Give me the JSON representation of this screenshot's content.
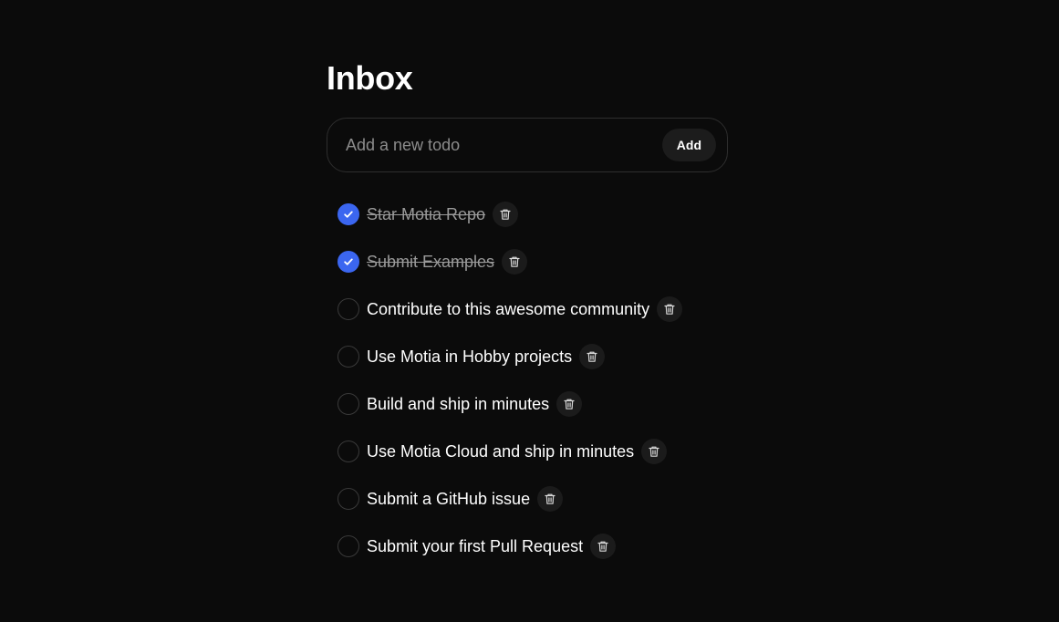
{
  "page": {
    "title": "Inbox"
  },
  "add_form": {
    "placeholder": "Add a new todo",
    "value": "",
    "button_label": "Add"
  },
  "todos": [
    {
      "text": "Star Motia Repo",
      "completed": true
    },
    {
      "text": "Submit Examples",
      "completed": true
    },
    {
      "text": "Contribute to this awesome community",
      "completed": false
    },
    {
      "text": "Use Motia in Hobby projects",
      "completed": false
    },
    {
      "text": "Build and ship in minutes",
      "completed": false
    },
    {
      "text": "Use Motia Cloud and ship in minutes",
      "completed": false
    },
    {
      "text": "Submit a GitHub issue",
      "completed": false
    },
    {
      "text": "Submit your first Pull Request",
      "completed": false
    }
  ],
  "icons": {
    "checked": "check-icon",
    "delete": "trash-icon"
  },
  "colors": {
    "background": "#0b0b0b",
    "accent": "#3b66f0",
    "text": "#ffffff",
    "muted_text": "#9a9a9a"
  }
}
